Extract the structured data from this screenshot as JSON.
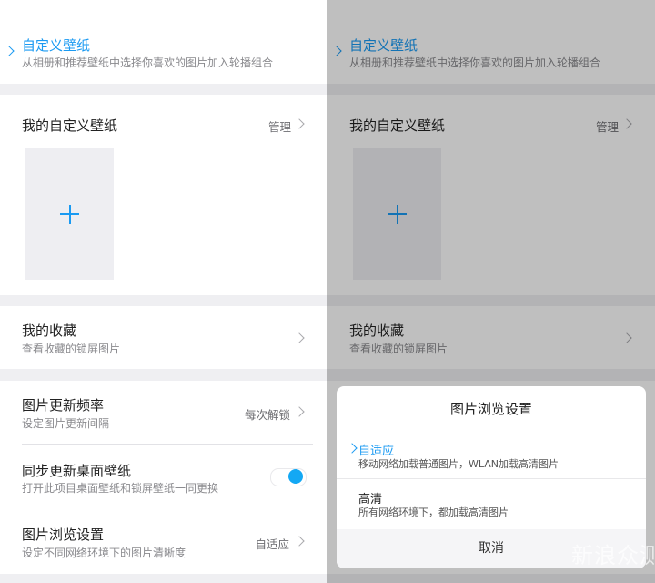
{
  "top": {
    "custom_wallpaper_title": "自定义壁纸",
    "custom_wallpaper_desc": "从相册和推荐壁纸中选择你喜欢的图片加入轮播组合"
  },
  "my_wallpapers": {
    "title": "我的自定义壁纸",
    "manage": "管理"
  },
  "favorites": {
    "title": "我的收藏",
    "desc": "查看收藏的锁屏图片"
  },
  "settings": [
    {
      "title": "图片更新频率",
      "desc": "设定图片更新间隔",
      "value": "每次解锁"
    },
    {
      "title": "同步更新桌面壁纸",
      "desc": "打开此项目桌面壁纸和锁屏壁纸一同更换",
      "toggle_on": true
    },
    {
      "title": "图片浏览设置",
      "desc": "设定不同网络环境下的图片清晰度",
      "value": "自适应"
    }
  ],
  "dialog": {
    "title": "图片浏览设置",
    "options": [
      {
        "label": "自适应",
        "desc": "移动网络加载普通图片，WLAN加载高清图片",
        "selected": true
      },
      {
        "label": "高清",
        "desc": "所有网络环境下，都加载高清图片",
        "selected": false
      }
    ],
    "cancel": "取消"
  },
  "watermark": "新浪众测",
  "colors": {
    "accent": "#1a9af2",
    "toggle": "#13a8f4"
  }
}
